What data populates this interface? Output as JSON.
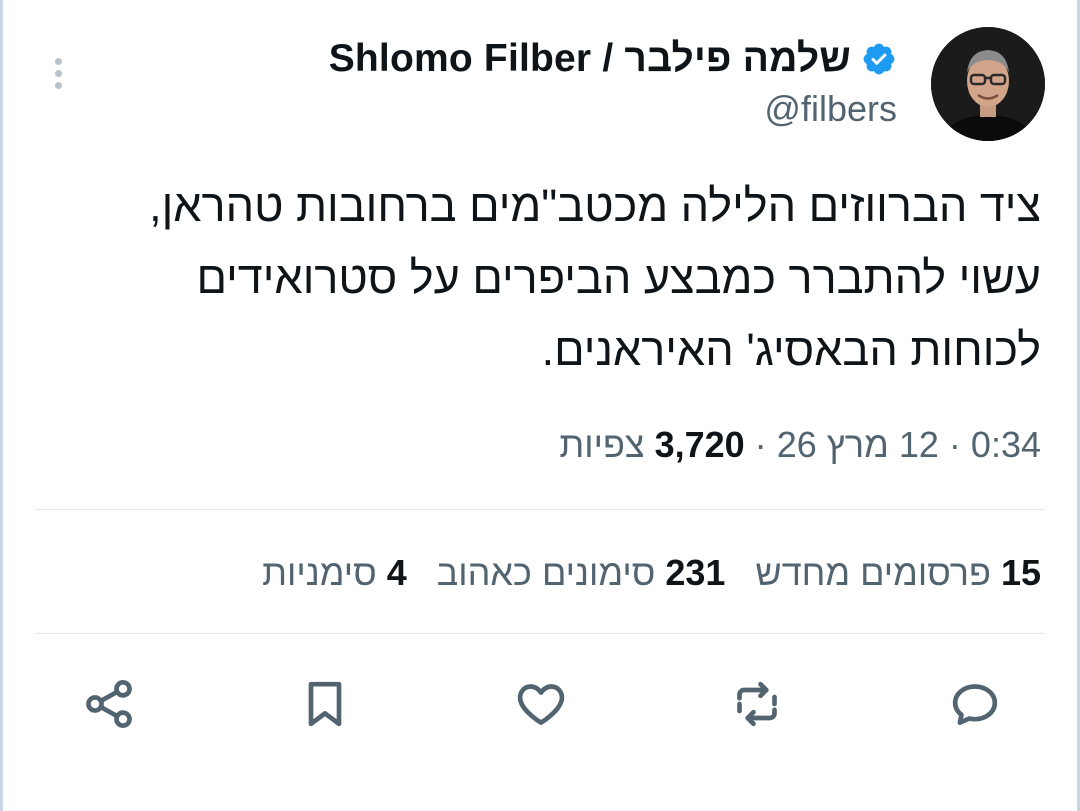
{
  "author": {
    "display_name": "Shlomo Filber / שלמה פילבר",
    "handle": "@filbers",
    "verified": true,
    "verified_color": "#1d9bf0"
  },
  "tweet": {
    "text": "ציד הברווזים הלילה מכטב\"מים ברחובות טהראן,\nעשוי להתברר כמבצע הביפרים על סטרואידים\nלכוחות הבאסיג' האיראנים."
  },
  "meta": {
    "time": "0:34",
    "date": "12 מרץ 26",
    "views_count": "3,720",
    "views_label": "צפיות",
    "separator": "·"
  },
  "stats": {
    "reposts_count": "15",
    "reposts_label": "פרסומים מחדש",
    "likes_count": "231",
    "likes_label": "סימונים כאהוב",
    "bookmarks_count": "4",
    "bookmarks_label": "סימניות"
  },
  "icons": {
    "more": "more-vertical-icon",
    "reply": "reply-icon",
    "repost": "repost-icon",
    "like": "heart-icon",
    "bookmark": "bookmark-icon",
    "share": "share-icon",
    "icon_color": "#536471"
  }
}
